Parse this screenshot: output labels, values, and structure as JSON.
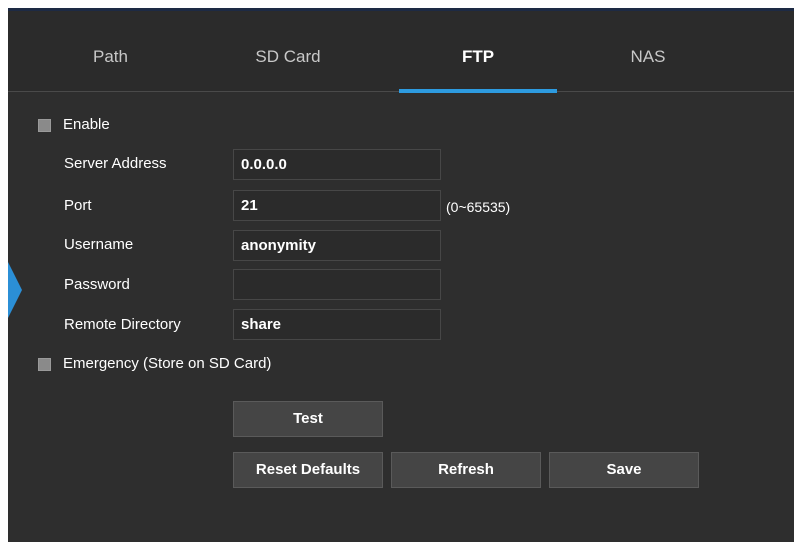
{
  "tabs": [
    {
      "label": "Path",
      "active": false
    },
    {
      "label": "SD Card",
      "active": false
    },
    {
      "label": "FTP",
      "active": true
    },
    {
      "label": "NAS",
      "active": false
    }
  ],
  "form": {
    "enable": {
      "label": "Enable",
      "checked": false
    },
    "server_address": {
      "label": "Server Address",
      "value": "0.0.0.0"
    },
    "port": {
      "label": "Port",
      "value": "21",
      "hint": "(0~65535)"
    },
    "username": {
      "label": "Username",
      "value": "anonymity"
    },
    "password": {
      "label": "Password",
      "value": ""
    },
    "remote_directory": {
      "label": "Remote Directory",
      "value": "share"
    },
    "emergency": {
      "label": "Emergency (Store on SD Card)",
      "checked": false
    }
  },
  "buttons": {
    "test": "Test",
    "reset_defaults": "Reset Defaults",
    "refresh": "Refresh",
    "save": "Save"
  },
  "colors": {
    "panel_background": "#2e2e2e",
    "active_tab_underline": "#2d9be0",
    "side_arrow": "#2b8fd6"
  }
}
